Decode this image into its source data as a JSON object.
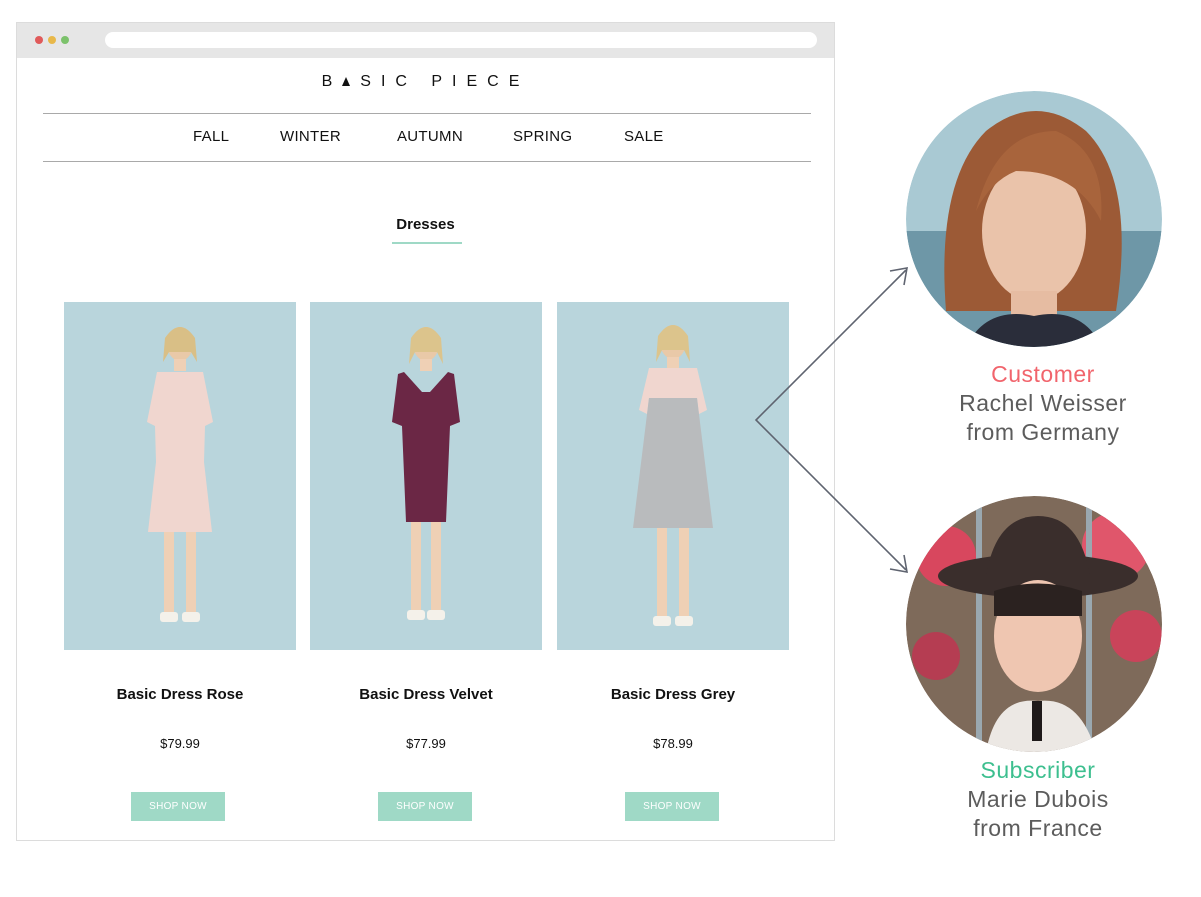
{
  "site": {
    "logo_left": "B",
    "logo_right": "SIC PIECE"
  },
  "nav": {
    "items": [
      {
        "label": "FALL"
      },
      {
        "label": "WINTER"
      },
      {
        "label": "AUTUMN"
      },
      {
        "label": "SPRING"
      },
      {
        "label": "SALE"
      }
    ]
  },
  "section": {
    "title": "Dresses"
  },
  "products": [
    {
      "name": "Basic Dress Rose",
      "price": "$79.99",
      "button": "SHOP NOW",
      "dress_color": "#f0d6cf"
    },
    {
      "name": "Basic Dress Velvet",
      "price": "$77.99",
      "button": "SHOP NOW",
      "dress_color": "#6b2745"
    },
    {
      "name": "Basic Dress Grey",
      "price": "$78.99",
      "button": "SHOP NOW",
      "dress_color": "#b9bbbd"
    }
  ],
  "personas": [
    {
      "role": "Customer",
      "name": "Rachel Weisser",
      "origin": "from Germany",
      "role_color": "#f1646c"
    },
    {
      "role": "Subscriber",
      "name": "Marie Dubois",
      "origin": "from France",
      "role_color": "#3dbf8f"
    }
  ],
  "colors": {
    "accent": "#9fd9c6",
    "product_background": "#b9d5dc"
  }
}
